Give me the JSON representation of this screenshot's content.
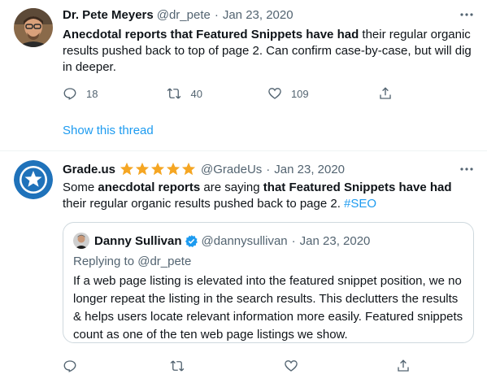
{
  "tweet1": {
    "display_name": "Dr. Pete Meyers",
    "handle": "@dr_pete",
    "separator": "·",
    "date": "Jan 23, 2020",
    "more_icon": "more-horizontal-icon",
    "text_bold": "Anecdotal reports that Featured Snippets have had",
    "text_rest": " their regular organic results pushed back to top of page 2. Can confirm case-by-case, but will dig in deeper.",
    "replies": "18",
    "retweets": "40",
    "likes": "109",
    "show_thread": "Show this thread"
  },
  "tweet2": {
    "display_name": "Grade.us",
    "star_count": 5,
    "star_color": "#f5a623",
    "handle": "@GradeUs",
    "separator": "·",
    "date": "Jan 23, 2020",
    "text_part1": "Some ",
    "text_bold1": "anecdotal reports",
    "text_part2": " are saying ",
    "text_bold2": "that Featured Snippets have had",
    "text_part3": " their regular organic results pushed back to page 2. ",
    "hashtag": "#SEO",
    "quote": {
      "display_name": "Danny Sullivan",
      "verified": true,
      "handle": "@dannysullivan",
      "separator": "·",
      "date": "Jan 23, 2020",
      "replying_to": "Replying to @dr_pete",
      "text": "If a web page listing is elevated into the featured snippet position, we no longer repeat the listing in the search results. This declutters the results & helps users locate relevant information more easily. Featured snippets count as one of the ten web page listings we show."
    }
  },
  "colors": {
    "accent": "#1d9bf0",
    "muted": "#536471",
    "brand_avatar_bg": "#1f72ba"
  }
}
